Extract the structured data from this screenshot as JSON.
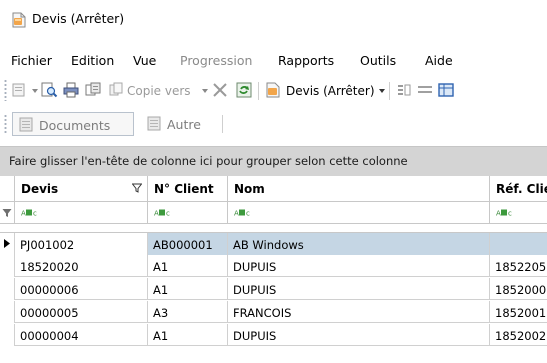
{
  "window": {
    "title": "Devis (Arrêter)",
    "icon": "document-stop-icon"
  },
  "menu": {
    "items": [
      {
        "label": "Fichier",
        "enabled": true
      },
      {
        "label": "Edition",
        "enabled": true
      },
      {
        "label": "Vue",
        "enabled": true
      },
      {
        "label": "Progression",
        "enabled": false
      },
      {
        "label": "Rapports",
        "enabled": true
      },
      {
        "label": "Outils",
        "enabled": true
      },
      {
        "label": "Aide",
        "enabled": true
      }
    ]
  },
  "toolbar": {
    "copy_label": "Copie vers",
    "status_label": "Devis (Arrêter)",
    "icons": [
      "new-icon",
      "preview-icon",
      "print-icon",
      "print-setup-icon",
      "copy-icon",
      "delete-icon",
      "refresh-icon",
      "status-icon",
      "columns-icon",
      "filter-rows-icon",
      "grid-icon"
    ]
  },
  "tabs": [
    {
      "label": "Documents",
      "active": true,
      "icon": "document-icon"
    },
    {
      "label": "Autre",
      "active": false,
      "icon": "document-icon"
    }
  ],
  "grid": {
    "group_prompt": "Faire glisser l'en-tête de colonne ici pour grouper selon cette colonne",
    "columns": [
      {
        "label": "Devis",
        "filter_icon": true
      },
      {
        "label": "N° Client",
        "filter_icon": false
      },
      {
        "label": "Nom",
        "filter_icon": false
      },
      {
        "label": "Réf. Clie",
        "filter_icon": false
      }
    ],
    "rows": [
      {
        "devis": "PJ001002",
        "client": "AB000001",
        "nom": "AB Windows",
        "ref": "",
        "selected": true
      },
      {
        "devis": "18520020",
        "client": "A1",
        "nom": "DUPUIS",
        "ref": "1852205",
        "selected": false
      },
      {
        "devis": "00000006",
        "client": "A1",
        "nom": "DUPUIS",
        "ref": "1852000",
        "selected": false
      },
      {
        "devis": "00000005",
        "client": "A3",
        "nom": "FRANCOIS",
        "ref": "1852001",
        "selected": false
      },
      {
        "devis": "00000004",
        "client": "A1",
        "nom": "DUPUIS",
        "ref": "1852002",
        "selected": false
      }
    ]
  }
}
